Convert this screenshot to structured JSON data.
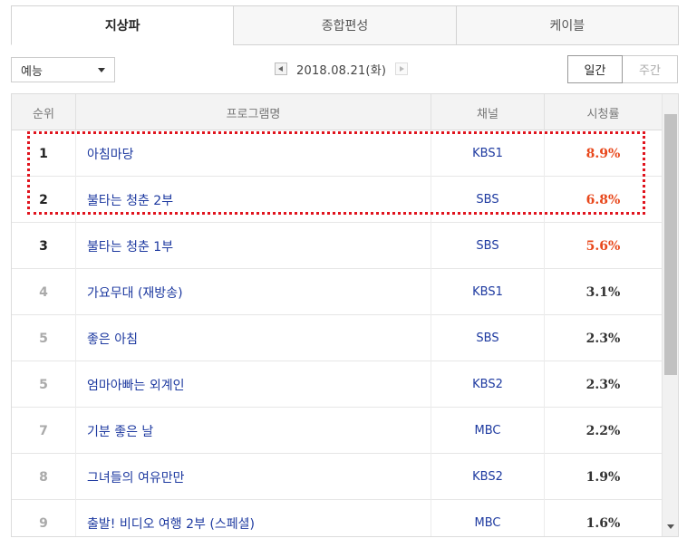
{
  "tabs": [
    {
      "label": "지상파",
      "active": true
    },
    {
      "label": "종합편성",
      "active": false
    },
    {
      "label": "케이블",
      "active": false
    }
  ],
  "genre": {
    "selected": "예능"
  },
  "date": {
    "text": "2018.08.21(화)"
  },
  "period": {
    "daily": "일간",
    "weekly": "주간"
  },
  "table": {
    "headers": {
      "rank": "순위",
      "name": "프로그램명",
      "channel": "채널",
      "rating": "시청률"
    },
    "rows": [
      {
        "rank": "1",
        "name": "아침마당",
        "channel": "KBS1",
        "rating": "8.9%"
      },
      {
        "rank": "2",
        "name": "불타는 청춘 2부",
        "channel": "SBS",
        "rating": "6.8%"
      },
      {
        "rank": "3",
        "name": "불타는 청춘 1부",
        "channel": "SBS",
        "rating": "5.6%"
      },
      {
        "rank": "4",
        "name": "가요무대 (재방송)",
        "channel": "KBS1",
        "rating": "3.1%"
      },
      {
        "rank": "5",
        "name": "좋은 아침",
        "channel": "SBS",
        "rating": "2.3%"
      },
      {
        "rank": "5",
        "name": "엄마아빠는 외계인",
        "channel": "KBS2",
        "rating": "2.3%"
      },
      {
        "rank": "7",
        "name": "기분 좋은 날",
        "channel": "MBC",
        "rating": "2.2%"
      },
      {
        "rank": "8",
        "name": "그녀들의 여유만만",
        "channel": "KBS2",
        "rating": "1.9%"
      },
      {
        "rank": "9",
        "name": "출발! 비디오 여행 2부 (스페셜)",
        "channel": "MBC",
        "rating": "1.6%"
      }
    ]
  },
  "colors": {
    "rating_hot": "#e8481c",
    "link": "#1e3aa0",
    "highlight": "#e0141e"
  },
  "icons": {
    "select_caret": "caret-down-icon",
    "prev": "arrow-left-icon",
    "next": "arrow-right-icon"
  }
}
